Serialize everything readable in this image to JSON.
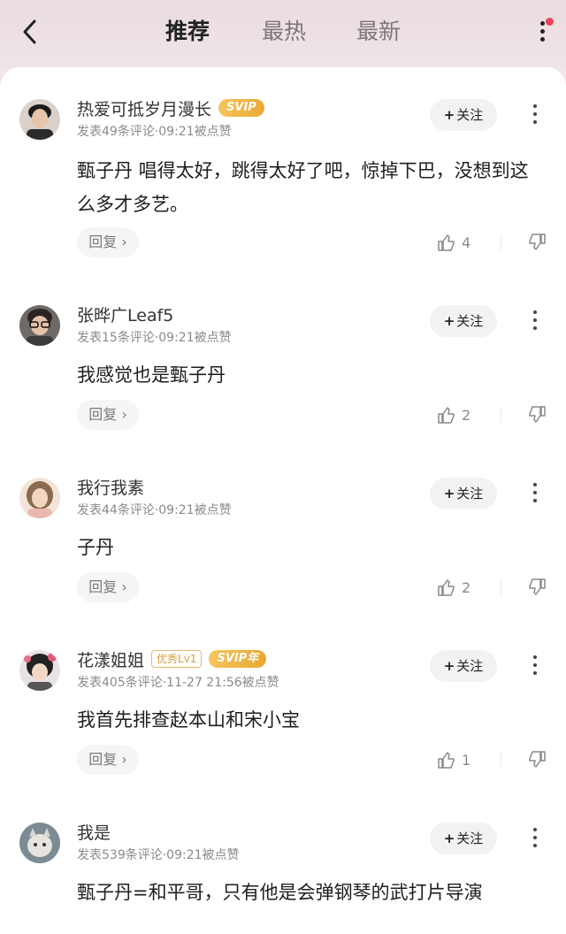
{
  "header": {
    "tabs": [
      {
        "label": "推荐",
        "active": true
      },
      {
        "label": "最热",
        "active": false
      },
      {
        "label": "最新",
        "active": false
      }
    ],
    "notification_dot_color": "#f0415a"
  },
  "follow_label": "关注",
  "reply_label": "回复",
  "comments": [
    {
      "username": "热爱可抵岁月漫长",
      "badges": [
        "SVIP"
      ],
      "meta": "发表49条评论·09:21被点赞",
      "text": "甄子丹 唱得太好，跳得太好了吧，惊掉下巴，没想到这么多才多艺。",
      "likes": "4"
    },
    {
      "username": "张晔广Leaf5",
      "badges": [],
      "meta": "发表15条评论·09:21被点赞",
      "text": "我感觉也是甄子丹",
      "likes": "2"
    },
    {
      "username": "我行我素",
      "badges": [],
      "meta": "发表44条评论·09:21被点赞",
      "text": "子丹",
      "likes": "2"
    },
    {
      "username": "花漾姐姐",
      "badges": [
        "优秀Lv1",
        "SVIP年"
      ],
      "meta": "发表405条评论·11-27 21:56被点赞",
      "text": "我首先排查赵本山和宋小宝",
      "likes": "1"
    },
    {
      "username": "我是",
      "badges": [],
      "meta": "发表539条评论·09:21被点赞",
      "text": "甄子丹=和平哥，只有他是会弹钢琴的武打片导演",
      "likes": ""
    }
  ],
  "colors": {
    "header_bg": "#efe5e7",
    "svip_gold": "#f0b544",
    "text_primary": "#1e1e1e",
    "text_secondary": "#8a8a8a"
  }
}
